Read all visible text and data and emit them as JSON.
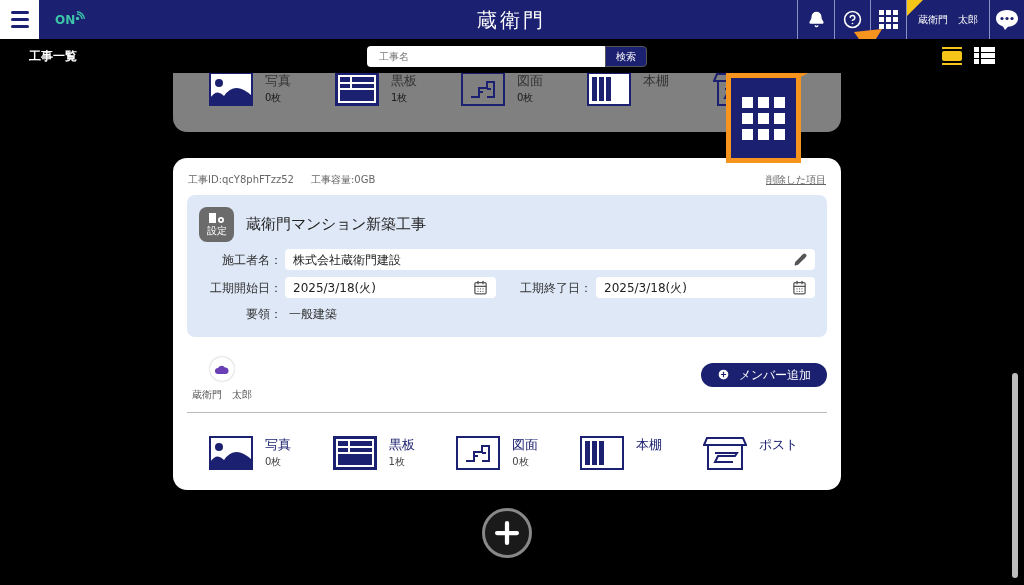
{
  "header": {
    "status": "ON",
    "logo": "蔵衛門",
    "user": "蔵衛門　太郎"
  },
  "page_title": "工事一覧",
  "search": {
    "placeholder": "工事名",
    "button": "検索"
  },
  "view_modes": [
    {
      "kind": "card",
      "selected": true
    },
    {
      "kind": "list",
      "selected": false
    }
  ],
  "dimmed_card": {
    "categories": [
      {
        "kind": "photo",
        "label": "写真",
        "count": "0枚"
      },
      {
        "kind": "board",
        "label": "黒板",
        "count": "1枚"
      },
      {
        "kind": "plan",
        "label": "図面",
        "count": "0枚"
      },
      {
        "kind": "shelf",
        "label": "本棚"
      },
      {
        "kind": "post"
      }
    ]
  },
  "project": {
    "id": "工事ID:qcY8phFTzz52",
    "capacity": "工事容量:0GB",
    "deleted_link": "削除した項目",
    "settings": "設定",
    "name": "蔵衛門マンション新築工事",
    "builder": {
      "label": "施工者名：",
      "value": "株式会社蔵衛門建設"
    },
    "start": {
      "label": "工期開始日：",
      "value": "2025/3/18(火)"
    },
    "end": {
      "label": "工期終了日：",
      "value": "2025/3/18(火)"
    },
    "outline": {
      "label": "要領：",
      "value": "一般建築"
    },
    "members": [
      {
        "name": "蔵衛門　太郎"
      }
    ],
    "add_member": "メンバー追加",
    "categories": [
      {
        "kind": "photo",
        "label": "写真",
        "count": "0枚"
      },
      {
        "kind": "board",
        "label": "黒板",
        "count": "1枚"
      },
      {
        "kind": "plan",
        "label": "図面",
        "count": "0枚"
      },
      {
        "kind": "shelf",
        "label": "本棚"
      },
      {
        "kind": "post",
        "label": "ポスト"
      }
    ]
  }
}
